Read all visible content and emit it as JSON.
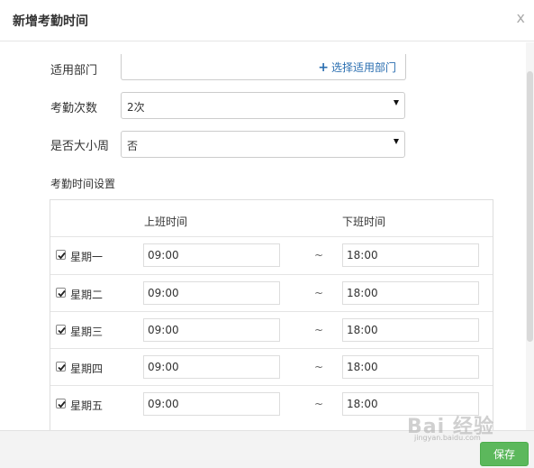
{
  "dialog": {
    "title": "新增考勤时间",
    "close_label": "x"
  },
  "form": {
    "department": {
      "label": "适用部门",
      "action_icon": "plus-icon",
      "action_label": "选择适用部门"
    },
    "attendance_count": {
      "label": "考勤次数",
      "value": "2次"
    },
    "alternate_week": {
      "label": "是否大小周",
      "value": "否"
    }
  },
  "time_settings": {
    "title": "考勤时间设置",
    "headers": {
      "start": "上班时间",
      "end": "下班时间"
    },
    "separator": "~",
    "rows": [
      {
        "day": "星期一",
        "checked": true,
        "start": "09:00",
        "end": "18:00"
      },
      {
        "day": "星期二",
        "checked": true,
        "start": "09:00",
        "end": "18:00"
      },
      {
        "day": "星期三",
        "checked": true,
        "start": "09:00",
        "end": "18:00"
      },
      {
        "day": "星期四",
        "checked": true,
        "start": "09:00",
        "end": "18:00"
      },
      {
        "day": "星期五",
        "checked": true,
        "start": "09:00",
        "end": "18:00"
      }
    ]
  },
  "footer": {
    "save_label": "保存"
  },
  "watermark": {
    "text": "Bai 经验",
    "sub": "jingyan.baidu.com"
  },
  "colors": {
    "link": "#2a6eb0",
    "save_button": "#5cb85c"
  }
}
